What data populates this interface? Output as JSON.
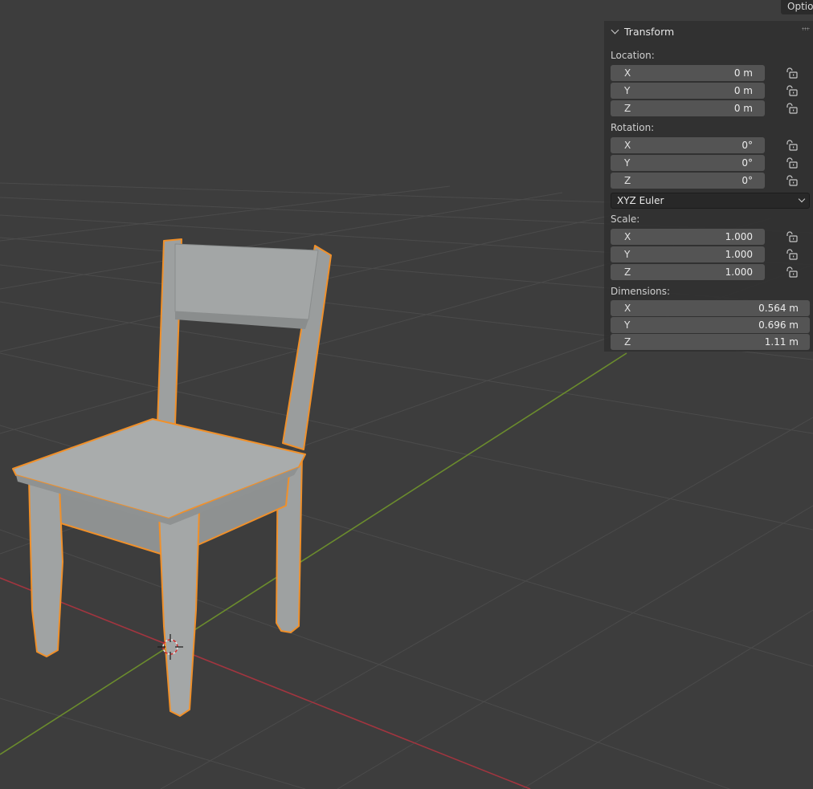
{
  "header": {
    "options_label": "Options"
  },
  "transform_panel": {
    "title": "Transform",
    "location": {
      "label": "Location:",
      "fields": [
        {
          "axis": "X",
          "value": "0 m"
        },
        {
          "axis": "Y",
          "value": "0 m"
        },
        {
          "axis": "Z",
          "value": "0 m"
        }
      ]
    },
    "rotation": {
      "label": "Rotation:",
      "fields": [
        {
          "axis": "X",
          "value": "0°"
        },
        {
          "axis": "Y",
          "value": "0°"
        },
        {
          "axis": "Z",
          "value": "0°"
        }
      ],
      "mode": "XYZ Euler"
    },
    "scale": {
      "label": "Scale:",
      "fields": [
        {
          "axis": "X",
          "value": "1.000"
        },
        {
          "axis": "Y",
          "value": "1.000"
        },
        {
          "axis": "Z",
          "value": "1.000"
        }
      ]
    },
    "dimensions": {
      "label": "Dimensions:",
      "fields": [
        {
          "axis": "X",
          "value": "0.564 m"
        },
        {
          "axis": "Y",
          "value": "0.696 m"
        },
        {
          "axis": "Z",
          "value": "1.11 m"
        }
      ]
    }
  },
  "colors": {
    "viewport_bg": "#3d3d3d",
    "grid_line": "#4a4a4a",
    "x_axis": "#a63a45",
    "y_axis": "#6a8a2c",
    "selection_outline": "#f0902a",
    "chair_body": "#9a9d9d"
  },
  "icons": {
    "lock": "unlocked-padlock-icon",
    "cursor": "3d-cursor-icon"
  }
}
